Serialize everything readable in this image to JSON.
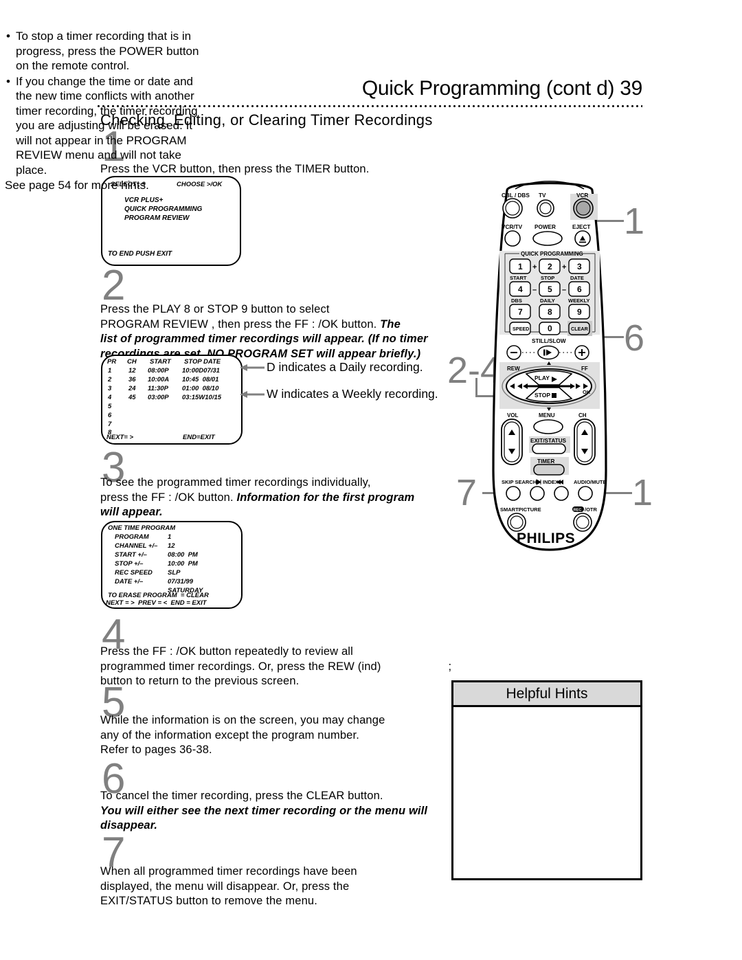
{
  "header": {
    "title": "Quick Programming (cont d)  39",
    "section": "Checking, Editing, or Clearing Timer Recordings"
  },
  "steps": [
    {
      "num": "1",
      "text": "Press the VCR button, then press the TIMER button."
    },
    {
      "num": "2",
      "line1": "Press the PLAY    8  or STOP  9  button to select",
      "line2": "PROGRAM REVIEW , then press the FF         : /OK button.  ",
      "bold1": "The",
      "bold2": "list of programmed timer recordings will appear. (If no timer",
      "bold3": "recordings are set, NO  PROGRAM  SET will appear briefly.)"
    },
    {
      "num": "3",
      "line1": "To see the programmed timer recordings individually,",
      "line2": "press the FF    : /OK button.  ",
      "bold1": "Information for the first program",
      "bold2": "will appear."
    },
    {
      "num": "4",
      "line1": "Press the FF    : /OK button repeatedly to review all",
      "line2": "programmed timer recordings. Or, press the REW (ind)",
      "line2b": ";",
      "line3": "button to return to the previous screen."
    },
    {
      "num": "5",
      "line1": "While the information is on the screen, you may change",
      "line2": "any of the information except the program number.",
      "line3": "Refer to pages 36-38."
    },
    {
      "num": "6",
      "line1": "To cancel the timer recording, press the CLEAR button.",
      "bold1": "You will either see the next timer recording or the menu will",
      "bold2": "disappear."
    },
    {
      "num": "7",
      "line1": "When all programmed timer recordings have been",
      "line2": "displayed, the menu will disappear. Or, press the",
      "line3": "EXIT/STATUS button to remove the menu."
    }
  ],
  "osd_menu": {
    "top_left": "SELECT , 9",
    "top_right": "CHOOSE >/OK",
    "items": [
      "VCR PLUS+",
      "QUICK PROGRAMMING",
      "PROGRAM REVIEW"
    ],
    "footer": "TO END PUSH EXIT"
  },
  "osd_review": {
    "headers": [
      "PR",
      "CH",
      "START",
      "STOP DATE"
    ],
    "rows": [
      {
        "pr": "1",
        "ch": "12",
        "start": "08:00P",
        "stop": "10:00D07/31"
      },
      {
        "pr": "2",
        "ch": "36",
        "start": "10:00A",
        "stop": "10:45  08/01"
      },
      {
        "pr": "3",
        "ch": "24",
        "start": "11:30P",
        "stop": "01:00  08/10"
      },
      {
        "pr": "4",
        "ch": "45",
        "start": "03:00P",
        "stop": "03:15W10/15"
      },
      {
        "pr": "5",
        "ch": "",
        "start": "",
        "stop": ""
      },
      {
        "pr": "6",
        "ch": "",
        "start": "",
        "stop": ""
      },
      {
        "pr": "7",
        "ch": "",
        "start": "",
        "stop": ""
      },
      {
        "pr": "8",
        "ch": "",
        "start": "",
        "stop": ""
      }
    ],
    "footer_left": "NEXT= >",
    "footer_right": "END=EXIT"
  },
  "annotations": {
    "daily": "D indicates a Daily recording.",
    "weekly": "W indicates a Weekly recording."
  },
  "osd_onetime": {
    "title": "ONE TIME PROGRAM",
    "rows": [
      {
        "label": "PROGRAM",
        "value": "1"
      },
      {
        "label": "CHANNEL +/–",
        "value": "12"
      },
      {
        "label": "START +/–",
        "value": "08:00  PM"
      },
      {
        "label": "STOP +/–",
        "value": "10:00  PM"
      },
      {
        "label": "REC SPEED",
        "value": "SLP"
      },
      {
        "label": "DATE +/–",
        "value": "07/31/99"
      },
      {
        "label": "",
        "value": "SATURDAY"
      }
    ],
    "footer1": "TO ERASE PROGRAM  = CLEAR",
    "footer2": "NEXT = >  PREV = <  END = EXIT"
  },
  "callouts": {
    "vcr": "1",
    "clear": "6",
    "rew_range": "2-4",
    "timer_left": "7",
    "timer_right": "1"
  },
  "remote": {
    "brand": "PHILIPS",
    "top_labels": [
      "CBL / DBS",
      "TV",
      "VCR"
    ],
    "second_labels": [
      "VCR/TV",
      "POWER",
      "EJECT"
    ],
    "keypad_title": "QUICK PROGRAMMING",
    "keypad_sublabels_1": [
      "START",
      "STOP",
      "DATE"
    ],
    "keypad_sublabels_2": [
      "DBS",
      "DAILY",
      "WEEKLY"
    ],
    "keys_row1": [
      "1",
      "2",
      "3"
    ],
    "keys_row2": [
      "4",
      "5",
      "6"
    ],
    "keys_row3": [
      "7",
      "8",
      "9"
    ],
    "keys_row4": [
      "SPEED",
      "0",
      "CLEAR"
    ],
    "stillslow": "STILL/SLOW",
    "rew": "REW",
    "ff": "FF",
    "play": "PLAY",
    "stop": "STOP",
    "ok": "OK",
    "vol": "VOL",
    "menu": "MENU",
    "ch": "CH",
    "exit_status": "EXIT/STATUS",
    "timer": "TIMER",
    "skip_search": "SKIP SEARCH",
    "index": "INDEX",
    "audio_mute": "AUDIO/MUTE",
    "smartpicture": "SMARTPICTURE",
    "otr": "/OTR",
    "otr_badge": "REC"
  },
  "hints": {
    "title": "Helpful Hints",
    "items": [
      "To stop a timer recording that is in progress, press the POWER button on the remote control.",
      "If you change the time or date and the new time conflicts with another timer recording, the timer recording you are adjusting will be erased. It will not appear in the PROGRAM REVIEW menu and will not take place."
    ],
    "see_more": "See page 54 for more hints."
  }
}
